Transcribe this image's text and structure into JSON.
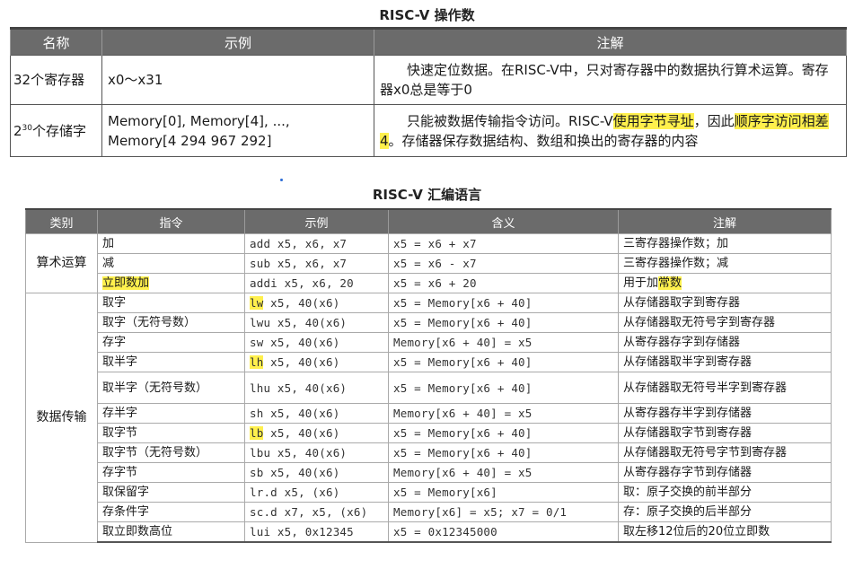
{
  "operands": {
    "title": "RISC-V 操作数",
    "headers": [
      "名称",
      "示例",
      "注解"
    ],
    "rows": [
      {
        "name": "32个寄存器",
        "example": "x0～x31",
        "note": "快速定位数据。在RISC-V中，只对寄存器中的数据执行算术运算。寄存器x0总是等于0"
      },
      {
        "name_base": "2",
        "name_exp": "30",
        "name_rest": "个存储字",
        "example_line1": "Memory[0], Memory[4], ...,",
        "example_line2": "Memory[4 294 967 292]",
        "note_part1": "只能被数据传输指令访问。RISC-V",
        "note_hl1": "使用字节寻址",
        "note_part2": "，因此",
        "note_hl2": "顺序字访问相差4",
        "note_part3": "。存储器保存数据结构、数组和换出的寄存器的内容"
      }
    ]
  },
  "assembly": {
    "title": "RISC-V 汇编语言",
    "headers": [
      "类别",
      "指令",
      "示例",
      "含义",
      "注解"
    ],
    "categories": [
      "算术运算",
      "数据传输"
    ],
    "rows": [
      {
        "instr": "加",
        "example": "add x5, x6, x7",
        "meaning": "x5 = x6 + x7",
        "note": "三寄存器操作数；加"
      },
      {
        "instr": "减",
        "example": "sub x5, x6, x7",
        "meaning": "x5 = x6 - x7",
        "note": "三寄存器操作数；减"
      },
      {
        "instr": "立即数加",
        "example": "addi x5, x6, 20",
        "meaning": "x5 = x6 + 20",
        "note_a": "用于加",
        "note_hl": "常数"
      },
      {
        "instr": "取字",
        "ex_hl": "lw",
        "ex_rest": " x5, 40(x6)",
        "meaning": "x5 = Memory[x6 + 40]",
        "note": "从存储器取字到寄存器"
      },
      {
        "instr": "取字（无符号数）",
        "example": "lwu x5, 40(x6)",
        "meaning": "x5 = Memory[x6 + 40]",
        "note": "从存储器取无符号字到寄存器"
      },
      {
        "instr": "存字",
        "example": "sw x5, 40(x6)",
        "meaning": "Memory[x6 + 40] = x5",
        "note": "从寄存器存字到存储器"
      },
      {
        "instr": "取半字",
        "ex_hl": "lh",
        "ex_rest": " x5, 40(x6)",
        "meaning": "x5 = Memory[x6 + 40]",
        "note": "从存储器取半字到寄存器"
      },
      {
        "instr": "取半字（无符号数）",
        "example": "lhu x5, 40(x6)",
        "meaning": "x5 = Memory[x6 + 40]",
        "note": "从存储器取无符号半字到寄存器"
      },
      {
        "instr": "存半字",
        "example": "sh x5, 40(x6)",
        "meaning": "Memory[x6 + 40] = x5",
        "note": "从寄存器存半字到存储器"
      },
      {
        "instr": "取字节",
        "ex_hl": "lb",
        "ex_rest": " x5, 40(x6)",
        "meaning": "x5 = Memory[x6 + 40]",
        "note": "从存储器取字节到寄存器"
      },
      {
        "instr": "取字节（无符号数）",
        "example": "lbu x5, 40(x6)",
        "meaning": "x5 = Memory[x6 + 40]",
        "note": "从存储器取无符号字节到寄存器"
      },
      {
        "instr": "存字节",
        "example": "sb x5, 40(x6)",
        "meaning": "Memory[x6 + 40] = x5",
        "note": "从寄存器存字节到存储器"
      },
      {
        "instr": "取保留字",
        "example": "lr.d x5, (x6)",
        "meaning": "x5 = Memory[x6]",
        "note": "取：原子交换的前半部分"
      },
      {
        "instr": "存条件字",
        "example": "sc.d x7, x5, (x6)",
        "meaning": "Memory[x6] = x5; x7 = 0/1",
        "note": "存：原子交换的后半部分"
      },
      {
        "instr": "取立即数高位",
        "example": "lui x5, 0x12345",
        "meaning": "x5 = 0x12345000",
        "note": "取左移12位后的20位立即数"
      }
    ]
  },
  "colors": {
    "header_bg": "#6b6b6b",
    "highlight": "#fff04d",
    "accent_dot": "#2a6bd6"
  }
}
